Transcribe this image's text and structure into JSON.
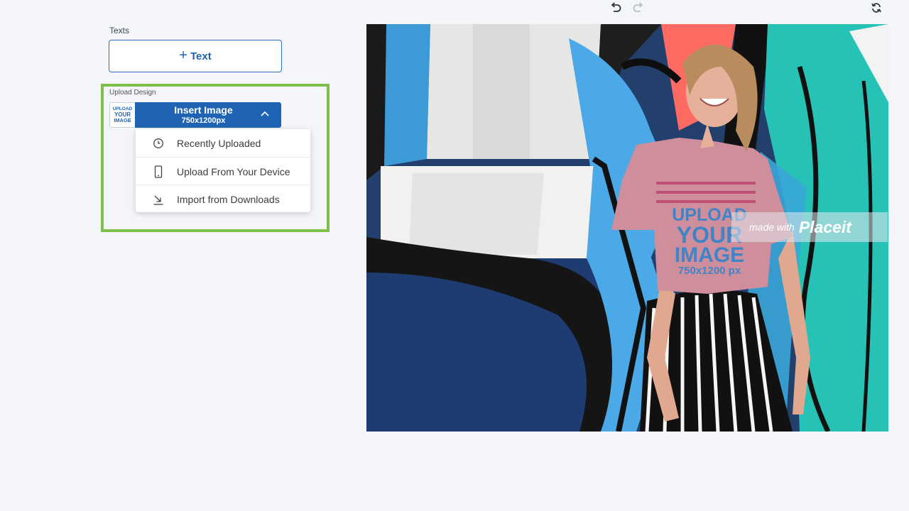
{
  "toolbar": {
    "undo_icon": "undo-icon",
    "redo_icon": "redo-icon",
    "refresh_icon": "refresh-icon"
  },
  "texts_section": {
    "label": "Texts",
    "add_text_plus": "+",
    "add_text_label": "Text"
  },
  "upload_section": {
    "label": "Upload Design",
    "thumb_lines": [
      "UPLOAD",
      "YOUR",
      "IMAGE"
    ],
    "insert_title": "Insert Image",
    "insert_size": "750x1200px",
    "dropdown": [
      {
        "label": "Recently Uploaded",
        "icon": "clock-icon"
      },
      {
        "label": "Upload From Your Device",
        "icon": "phone-icon"
      },
      {
        "label": "Import from Downloads",
        "icon": "download-icon"
      }
    ]
  },
  "preview": {
    "shirt_lines": [
      "UPLOAD",
      "YOUR",
      "IMAGE",
      "750x1200 px"
    ],
    "watermark_prefix": "made with",
    "watermark_brand": "Placeit"
  },
  "colors": {
    "accent": "#1f64b4",
    "highlight": "#7cc04b",
    "background": "#f3f5f9"
  }
}
